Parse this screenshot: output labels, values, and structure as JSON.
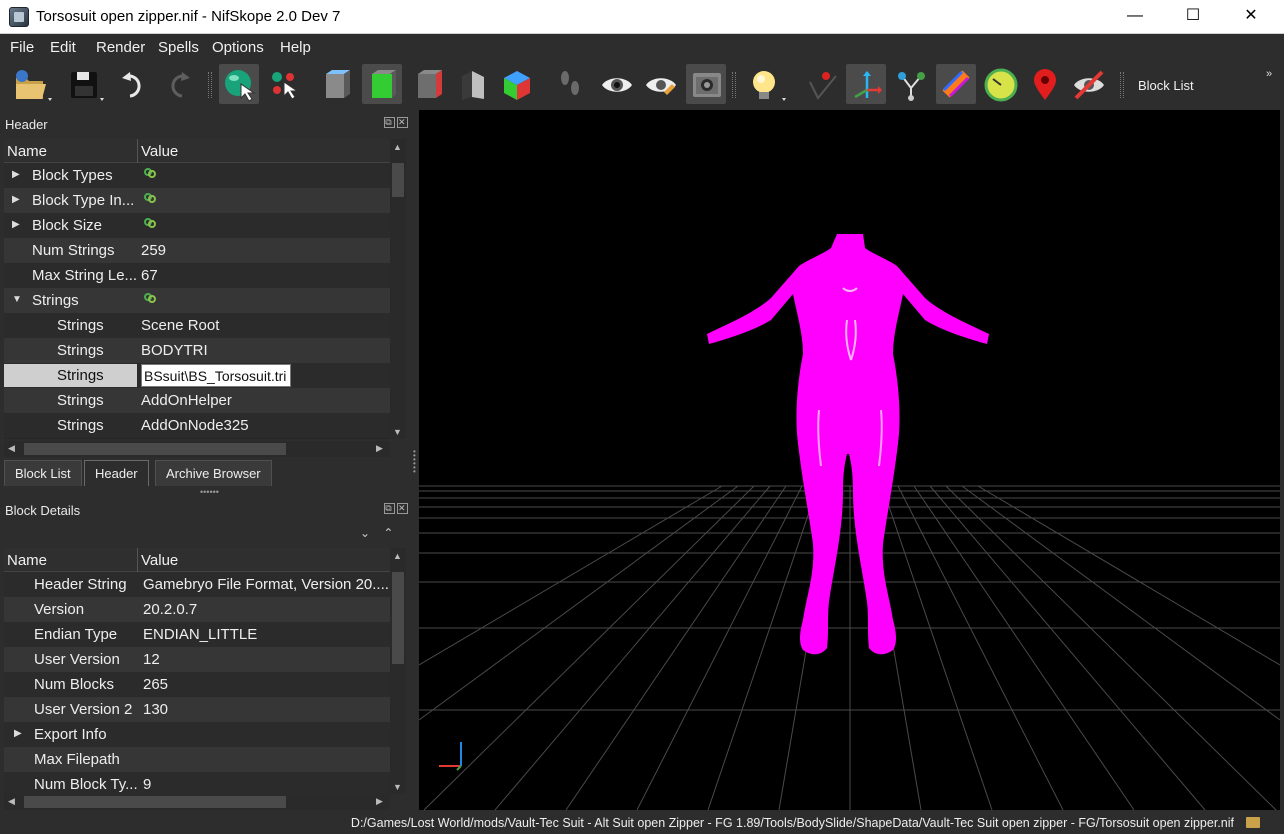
{
  "window": {
    "title": "Torsosuit open zipper.nif - NifSkope 2.0 Dev 7",
    "minimize_glyph": "—",
    "maximize_glyph": "☐",
    "close_glyph": "✕"
  },
  "menu": {
    "items": [
      "File",
      "Edit",
      "Render",
      "Spells",
      "Options",
      "Help"
    ]
  },
  "toolbar": {
    "block_list_label": "Block List",
    "overflow_glyph": "»",
    "icons": [
      "open-icon",
      "save-icon",
      "undo-icon",
      "redo-icon",
      "select-object-icon",
      "select-vertex-icon",
      "view-front-icon",
      "view-side-icon",
      "view-top-icon",
      "view-solid-icon",
      "view-color-icon",
      "walk-icon",
      "eye-icon",
      "eye-edit-icon",
      "screenshot-icon",
      "light-icon",
      "pin-icon",
      "axes-icon",
      "nodes-icon",
      "constraints-icon",
      "radar-icon",
      "marker-icon",
      "hide-icon"
    ],
    "accent": "#ff9800"
  },
  "header_panel": {
    "title": "Header",
    "columns": [
      "Name",
      "Value"
    ],
    "rows": [
      {
        "name": "Block Types",
        "value": "",
        "expandable": true,
        "link": true
      },
      {
        "name": "Block Type In...",
        "value": "",
        "expandable": true,
        "link": true
      },
      {
        "name": "Block Size",
        "value": "",
        "expandable": true,
        "link": true
      },
      {
        "name": "Num Strings",
        "value": "259"
      },
      {
        "name": "Max String Le...",
        "value": "67"
      },
      {
        "name": "Strings",
        "value": "",
        "expanded": true,
        "link": true
      },
      {
        "name": "Strings",
        "value": "Scene Root"
      },
      {
        "name": "Strings",
        "value": "BODYTRI"
      },
      {
        "name": "Strings",
        "value": "BSsuit\\BS_Torsosuit.tri",
        "selected": true,
        "editing": true
      },
      {
        "name": "Strings",
        "value": "AddOnHelper"
      },
      {
        "name": "Strings",
        "value": "AddOnNode325"
      }
    ]
  },
  "tabs": {
    "items": [
      "Block List",
      "Header",
      "Archive Browser"
    ],
    "active": "Header"
  },
  "block_details": {
    "title": "Block Details",
    "columns": [
      "Name",
      "Value"
    ],
    "rows": [
      {
        "name": "Header String",
        "value": "Gamebryo File Format, Version 20...."
      },
      {
        "name": "Version",
        "value": "20.2.0.7"
      },
      {
        "name": "Endian Type",
        "value": "ENDIAN_LITTLE"
      },
      {
        "name": "User Version",
        "value": "12"
      },
      {
        "name": "Num Blocks",
        "value": "265"
      },
      {
        "name": "User Version 2",
        "value": "130"
      },
      {
        "name": "Export Info",
        "value": "",
        "expandable": true
      },
      {
        "name": "Max Filepath",
        "value": ""
      },
      {
        "name": "Num Block Ty...",
        "value": "9"
      }
    ]
  },
  "viewport": {
    "background": "#000000",
    "model_color": "#ff00ff",
    "grid_color": "#555555"
  },
  "status": {
    "path": "D:/Games/Lost World/mods/Vault-Tec Suit - Alt Suit open Zipper - FG 1.89/Tools/BodySlide/ShapeData/Vault-Tec Suit open zipper - FG/Torsosuit open zipper.nif"
  }
}
